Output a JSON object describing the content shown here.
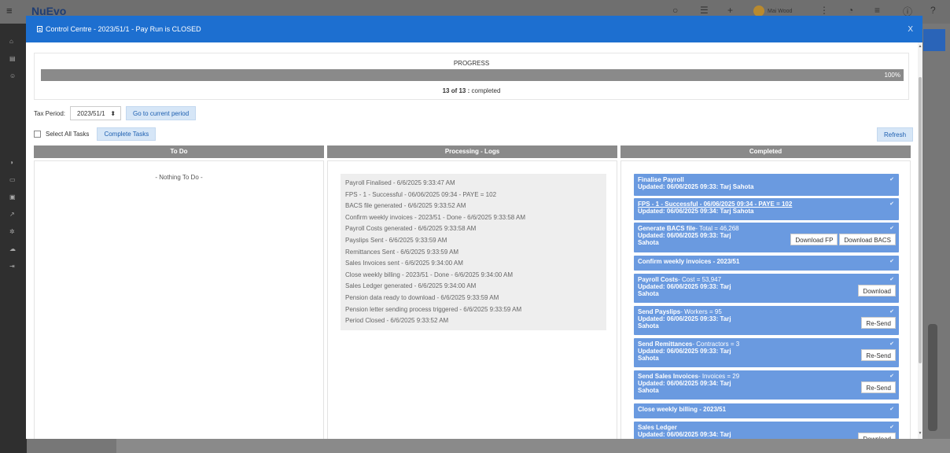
{
  "background": {
    "logo": "NuEvo",
    "user_name": "Mai Wood"
  },
  "modal": {
    "title": "Control Centre - 2023/51/1 - Pay Run is CLOSED",
    "close_label": "X"
  },
  "progress": {
    "label": "PROGRESS",
    "percent": 100,
    "percent_label": "100%",
    "count_bold": "13 of 13 :",
    "count_text": " completed"
  },
  "tax_period": {
    "label": "Tax Period:",
    "value": "2023/51/1",
    "go_button": "Go to current period"
  },
  "select_all": {
    "label": "Select All Tasks",
    "complete_button": "Complete Tasks",
    "refresh_button": "Refresh"
  },
  "columns": {
    "todo": "To Do",
    "logs": "Processing - Logs",
    "completed": "Completed"
  },
  "todo": {
    "empty_text": "- Nothing To Do -"
  },
  "logs": [
    "Payroll Finalised - 6/6/2025 9:33:47 AM",
    "FPS - 1 - Successful - 06/06/2025 09:34 - PAYE = 102",
    "BACS file generated - 6/6/2025 9:33:52 AM",
    "Confirm weekly invoices - 2023/51 - Done - 6/6/2025 9:33:58 AM",
    "Payroll Costs generated - 6/6/2025 9:33:58 AM",
    "Payslips Sent - 6/6/2025 9:33:59 AM",
    "Remittances Sent - 6/6/2025 9:33:59 AM",
    "Sales Invoices sent - 6/6/2025 9:34:00 AM",
    "Close weekly billing - 2023/51 - Done - 6/6/2025 9:34:00 AM",
    "Sales Ledger generated - 6/6/2025 9:34:00 AM",
    "Pension data ready to download - 6/6/2025 9:33:59 AM",
    "Pension letter sending process triggered - 6/6/2025 9:33:59 AM",
    "Period Closed - 6/6/2025 9:33:52 AM"
  ],
  "completed": [
    {
      "title": "Finalise Payroll",
      "detail": "",
      "updated": "Updated: 06/06/2025 09:33: Tarj Sahota"
    },
    {
      "title": "FPS - 1 - Successful - 06/06/2025 09:34 - PAYE = 102",
      "detail": "",
      "updated": "Updated: 06/06/2025 09:34: Tarj Sahota"
    },
    {
      "title": "Generate BACS file",
      "detail": "- Total = 46,268",
      "updated": "Updated: 06/06/2025 09:33: Tarj",
      "updated2": "Sahota",
      "buttons": [
        "Download FP",
        "Download BACS"
      ]
    },
    {
      "title": "Confirm weekly invoices - 2023/51",
      "detail": "",
      "updated": ""
    },
    {
      "title": "Payroll Costs",
      "detail": "- Cost = 53,947",
      "updated": "Updated: 06/06/2025 09:33: Tarj",
      "updated2": "Sahota",
      "buttons": [
        "Download"
      ]
    },
    {
      "title": "Send Payslips",
      "detail": "- Workers = 95",
      "updated": "Updated: 06/06/2025 09:33: Tarj",
      "updated2": "Sahota",
      "buttons": [
        "Re-Send"
      ]
    },
    {
      "title": "Send Remittances",
      "detail": "- Contractors = 3",
      "updated": "Updated: 06/06/2025 09:33: Tarj",
      "updated2": "Sahota",
      "buttons": [
        "Re-Send"
      ]
    },
    {
      "title": "Send Sales Invoices",
      "detail": "- Invoices = 29",
      "updated": "Updated: 06/06/2025 09:34: Tarj",
      "updated2": "Sahota",
      "buttons": [
        "Re-Send"
      ]
    },
    {
      "title": "Close weekly billing - 2023/51",
      "detail": "",
      "updated": ""
    },
    {
      "title": "Sales Ledger",
      "detail": "",
      "updated": "Updated: 06/06/2025 09:34: Tarj",
      "updated2": "",
      "buttons": [
        "Download"
      ]
    }
  ],
  "colors": {
    "header_blue": "#1d6fd0",
    "task_blue": "#6a9ae0",
    "column_header_gray": "#8a8a8a"
  }
}
